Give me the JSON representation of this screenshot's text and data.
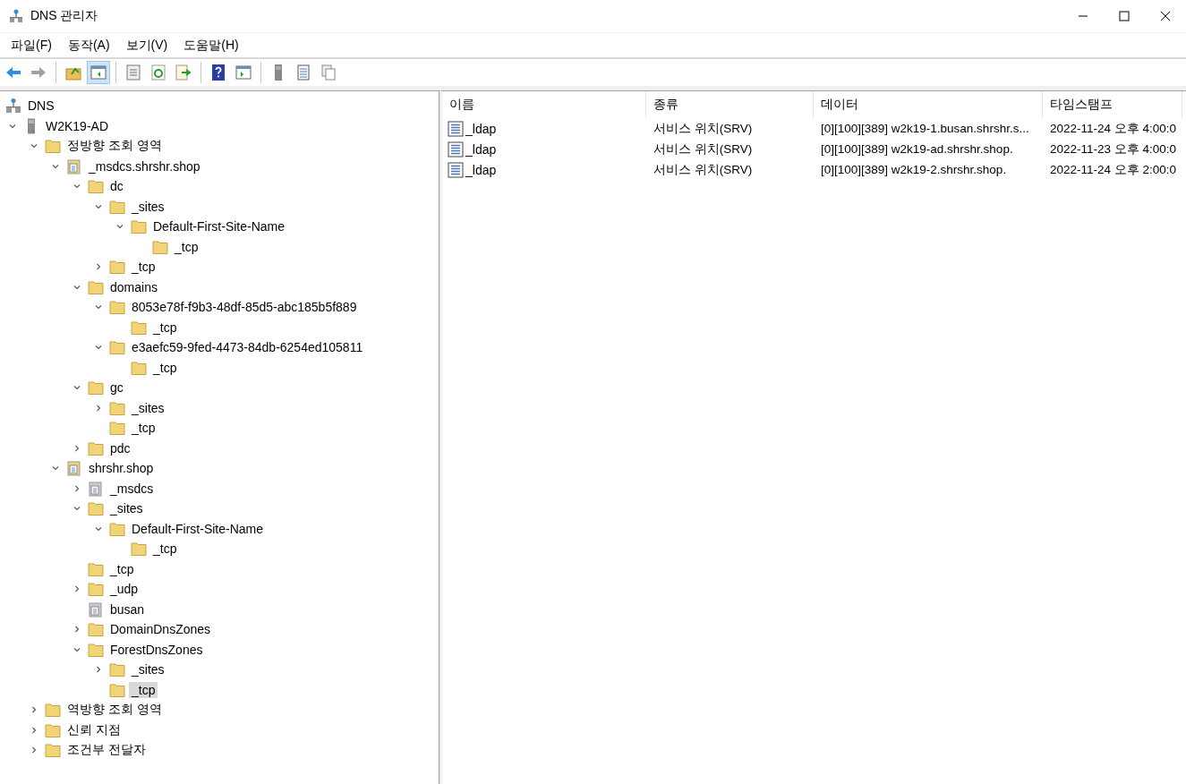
{
  "window": {
    "title": "DNS 관리자"
  },
  "menu": [
    "파일(F)",
    "동작(A)",
    "보기(V)",
    "도움말(H)"
  ],
  "toolbar": [
    [
      {
        "kind": "back",
        "disabled": false,
        "pressed": false
      },
      {
        "kind": "forward",
        "disabled": true,
        "pressed": false
      }
    ],
    [
      {
        "kind": "up",
        "disabled": false,
        "pressed": false
      },
      {
        "kind": "tree-pane",
        "disabled": false,
        "pressed": true
      }
    ],
    [
      {
        "kind": "properties",
        "disabled": false,
        "pressed": false
      },
      {
        "kind": "refresh",
        "disabled": false,
        "pressed": false
      },
      {
        "kind": "export",
        "disabled": false,
        "pressed": false
      }
    ],
    [
      {
        "kind": "help",
        "disabled": false,
        "pressed": false
      },
      {
        "kind": "action-pane",
        "disabled": false,
        "pressed": false
      }
    ],
    [
      {
        "kind": "server",
        "disabled": false,
        "pressed": false
      },
      {
        "kind": "list",
        "disabled": false,
        "pressed": false
      },
      {
        "kind": "copy",
        "disabled": false,
        "pressed": false
      }
    ]
  ],
  "tree": [
    {
      "label": "DNS",
      "kind": "dns",
      "selected": false,
      "children": [
        {
          "label": "W2K19-AD",
          "kind": "server",
          "expanded": true,
          "selected": false,
          "children": [
            {
              "label": "정방향 조회 영역",
              "kind": "folder",
              "expanded": true,
              "selected": false,
              "children": [
                {
                  "label": "_msdcs.shrshr.shop",
                  "kind": "zone",
                  "expanded": true,
                  "selected": false,
                  "children": [
                    {
                      "label": "dc",
                      "kind": "folder",
                      "expanded": true,
                      "selected": false,
                      "children": [
                        {
                          "label": "_sites",
                          "kind": "folder",
                          "expanded": true,
                          "selected": false,
                          "children": [
                            {
                              "label": "Default-First-Site-Name",
                              "kind": "folder",
                              "expanded": true,
                              "selected": false,
                              "children": [
                                {
                                  "label": "_tcp",
                                  "kind": "folder",
                                  "selected": false
                                }
                              ]
                            }
                          ]
                        },
                        {
                          "label": "_tcp",
                          "kind": "folder",
                          "expanded": false,
                          "selected": false
                        }
                      ]
                    },
                    {
                      "label": "domains",
                      "kind": "folder",
                      "expanded": true,
                      "selected": false,
                      "children": [
                        {
                          "label": "8053e78f-f9b3-48df-85d5-abc185b5f889",
                          "kind": "folder",
                          "expanded": true,
                          "selected": false,
                          "children": [
                            {
                              "label": "_tcp",
                              "kind": "folder",
                              "selected": false
                            }
                          ]
                        },
                        {
                          "label": "e3aefc59-9fed-4473-84db-6254ed105811",
                          "kind": "folder",
                          "expanded": true,
                          "selected": false,
                          "children": [
                            {
                              "label": "_tcp",
                              "kind": "folder",
                              "selected": false
                            }
                          ]
                        }
                      ]
                    },
                    {
                      "label": "gc",
                      "kind": "folder",
                      "expanded": true,
                      "selected": false,
                      "children": [
                        {
                          "label": "_sites",
                          "kind": "folder",
                          "expanded": false,
                          "selected": false
                        },
                        {
                          "label": "_tcp",
                          "kind": "folder",
                          "selected": false
                        }
                      ]
                    },
                    {
                      "label": "pdc",
                      "kind": "folder",
                      "expanded": false,
                      "selected": false
                    }
                  ]
                },
                {
                  "label": "shrshr.shop",
                  "kind": "zone",
                  "expanded": true,
                  "selected": false,
                  "children": [
                    {
                      "label": "_msdcs",
                      "kind": "zone-delegated",
                      "expanded": false,
                      "selected": false
                    },
                    {
                      "label": "_sites",
                      "kind": "folder",
                      "expanded": true,
                      "selected": false,
                      "children": [
                        {
                          "label": "Default-First-Site-Name",
                          "kind": "folder",
                          "expanded": true,
                          "selected": false,
                          "children": [
                            {
                              "label": "_tcp",
                              "kind": "folder",
                              "selected": false
                            }
                          ]
                        }
                      ]
                    },
                    {
                      "label": "_tcp",
                      "kind": "folder",
                      "selected": false
                    },
                    {
                      "label": "_udp",
                      "kind": "folder",
                      "expanded": false,
                      "selected": false
                    },
                    {
                      "label": "busan",
                      "kind": "zone-delegated",
                      "selected": false
                    },
                    {
                      "label": "DomainDnsZones",
                      "kind": "folder",
                      "expanded": false,
                      "selected": false
                    },
                    {
                      "label": "ForestDnsZones",
                      "kind": "folder",
                      "expanded": true,
                      "selected": false,
                      "children": [
                        {
                          "label": "_sites",
                          "kind": "folder",
                          "expanded": false,
                          "selected": false
                        },
                        {
                          "label": "_tcp",
                          "kind": "folder",
                          "selected": true
                        }
                      ]
                    }
                  ]
                }
              ]
            },
            {
              "label": "역방향 조회 영역",
              "kind": "folder",
              "expanded": false,
              "selected": false
            },
            {
              "label": "신뢰 지점",
              "kind": "folder",
              "expanded": false,
              "selected": false
            },
            {
              "label": "조건부 전달자",
              "kind": "folder",
              "expanded": false,
              "selected": false
            }
          ]
        }
      ]
    }
  ],
  "table": {
    "columns": [
      "이름",
      "종류",
      "데이터",
      "타임스탬프"
    ],
    "rows": [
      [
        "_ldap",
        "서비스 위치(SRV)",
        "[0][100][389] w2k19-1.busan.shrshr.s...",
        "2022-11-24 오후 4:00:0"
      ],
      [
        "_ldap",
        "서비스 위치(SRV)",
        "[0][100][389] w2k19-ad.shrshr.shop.",
        "2022-11-23 오후 4:00:0"
      ],
      [
        "_ldap",
        "서비스 위치(SRV)",
        "[0][100][389] w2k19-2.shrshr.shop.",
        "2022-11-24 오후 2:00:0"
      ]
    ]
  }
}
